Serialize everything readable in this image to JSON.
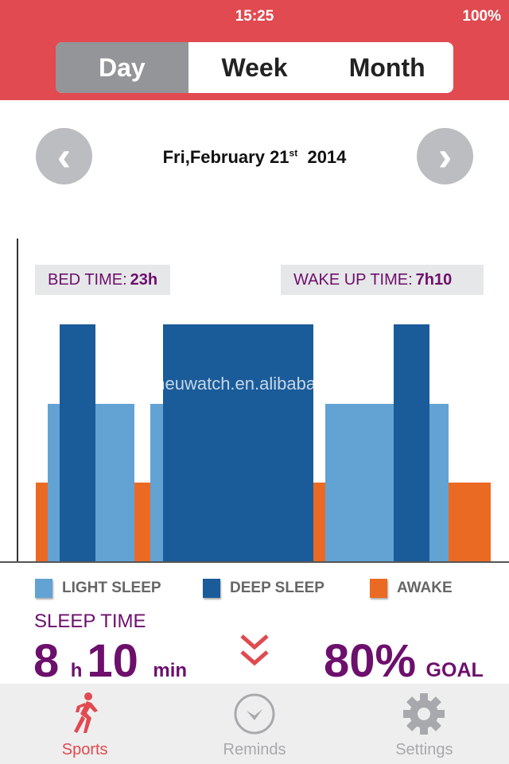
{
  "status": {
    "time": "15:25",
    "battery": "100%"
  },
  "tabs": [
    {
      "label": "Day",
      "active": true
    },
    {
      "label": "Week"
    },
    {
      "label": "Month"
    }
  ],
  "date": {
    "main": "Fri,February 21",
    "suffix": "st",
    "year": "2014"
  },
  "bed_time": {
    "label": "BED TIME:",
    "value": "23h"
  },
  "wake_time": {
    "label": "WAKE UP TIME:",
    "value": "7h10"
  },
  "watermark": "neuwatch.en.alibaba.com",
  "colors": {
    "light": "#62a3d4",
    "deep": "#1a5b9a",
    "awake": "#eb6a23",
    "accent": "#e04a50",
    "purple": "#6d0f6d"
  },
  "sleep_stages": [
    "awake",
    "light",
    "deep",
    "light",
    "awake",
    "light",
    "deep",
    "awake",
    "light",
    "deep",
    "light",
    "awake"
  ],
  "legend": {
    "light": "LIGHT SLEEP",
    "deep": "DEEP SLEEP",
    "awake": "AWAKE"
  },
  "summary": {
    "label": "SLEEP TIME",
    "hours": "8",
    "h_unit": "h",
    "minutes": "10",
    "min_unit": "min",
    "goal_percent": "80%",
    "goal_label": "GOAL"
  },
  "bottom_nav": [
    {
      "label": "Sports",
      "icon": "runner-icon",
      "active": true
    },
    {
      "label": "Reminds",
      "icon": "clock-icon"
    },
    {
      "label": "Settings",
      "icon": "gear-icon"
    }
  ]
}
